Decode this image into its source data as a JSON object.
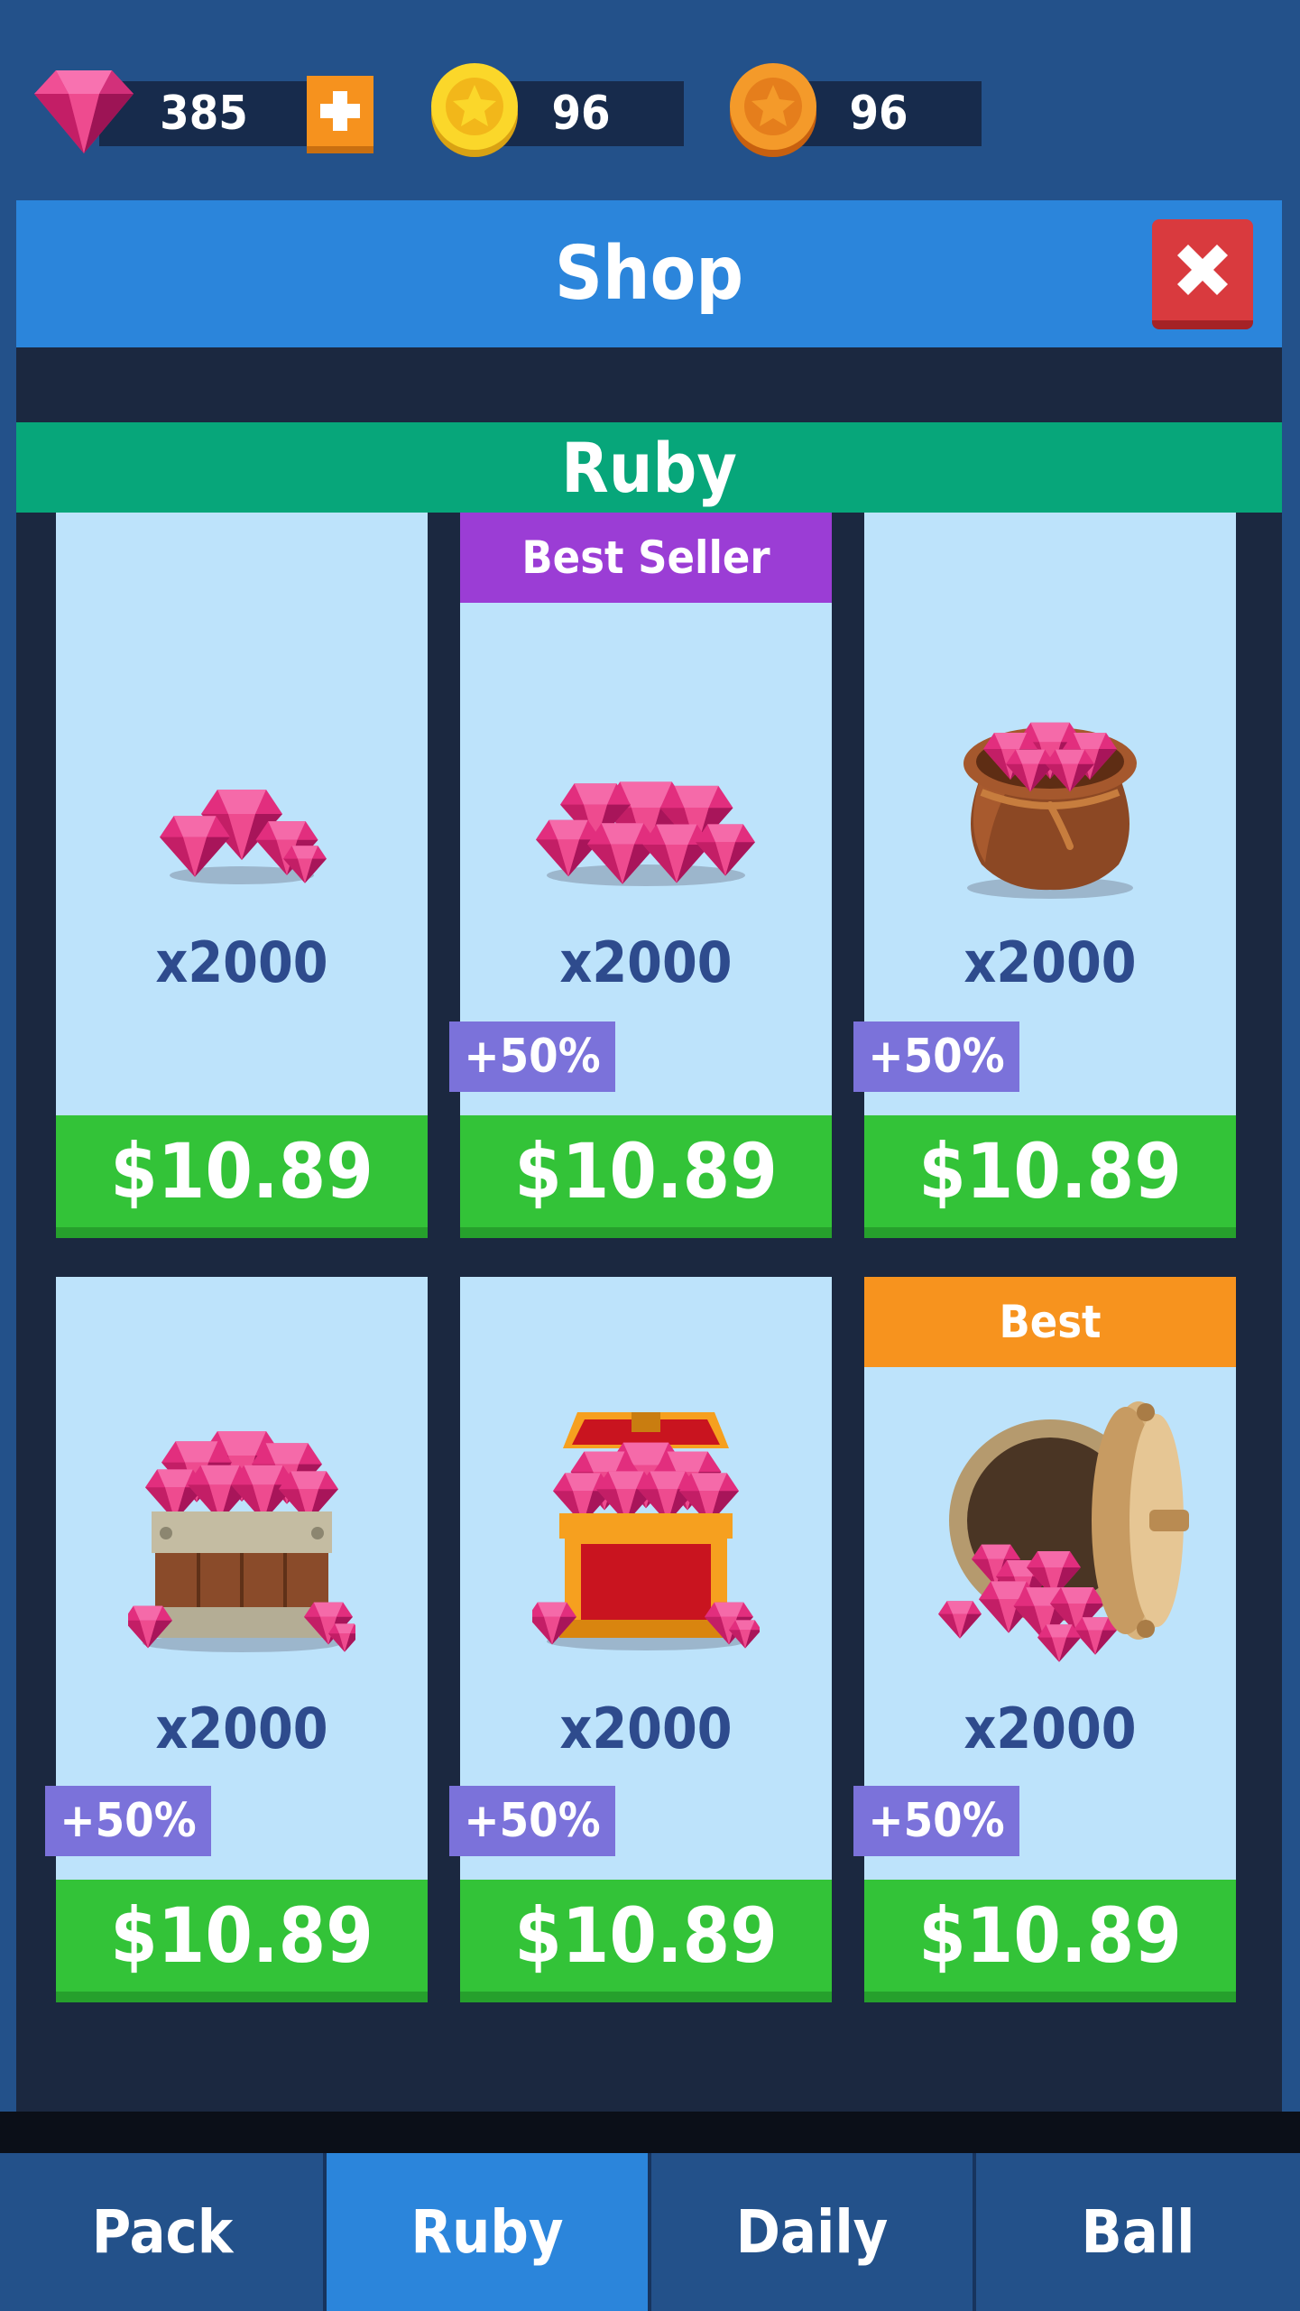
{
  "currency": {
    "ruby": {
      "value": "385",
      "icon": "ruby-gem-icon",
      "add_icon": "plus-icon"
    },
    "gold": {
      "value": "96",
      "icon": "gold-coin-star-icon"
    },
    "bronze": {
      "value": "96",
      "icon": "bronze-coin-star-icon"
    }
  },
  "header": {
    "title": "Shop",
    "close_icon": "close-x-icon"
  },
  "section": {
    "title": "Ruby"
  },
  "items": [
    {
      "ribbon": "",
      "quantity": "x2000",
      "bonus": "",
      "price": "$10.89",
      "illustration": "small-ruby-pile"
    },
    {
      "ribbon": "Best Seller",
      "quantity": "x2000",
      "bonus": "+50%",
      "price": "$10.89",
      "illustration": "large-ruby-pile"
    },
    {
      "ribbon": "",
      "quantity": "x2000",
      "bonus": "+50%",
      "price": "$10.89",
      "illustration": "ruby-sack"
    },
    {
      "ribbon": "",
      "quantity": "x2000",
      "bonus": "+50%",
      "price": "$10.89",
      "illustration": "ruby-crate"
    },
    {
      "ribbon": "",
      "quantity": "x2000",
      "bonus": "+50%",
      "price": "$10.89",
      "illustration": "ruby-chest"
    },
    {
      "ribbon": "Best",
      "quantity": "x2000",
      "bonus": "+50%",
      "price": "$10.89",
      "illustration": "ruby-vault"
    }
  ],
  "tabs": [
    {
      "label": "Pack",
      "active": false
    },
    {
      "label": "Ruby",
      "active": true
    },
    {
      "label": "Daily",
      "active": false
    },
    {
      "label": "Ball",
      "active": false
    }
  ],
  "colors": {
    "background": "#23518a",
    "header": "#2b85db",
    "section": "#07a67a",
    "card": "#bde3fb",
    "price": "#33c338",
    "bonus": "#7b72da",
    "ribbon_best_seller": "#9b3dd5",
    "ribbon_best": "#f7931e",
    "close": "#d93a3e"
  }
}
